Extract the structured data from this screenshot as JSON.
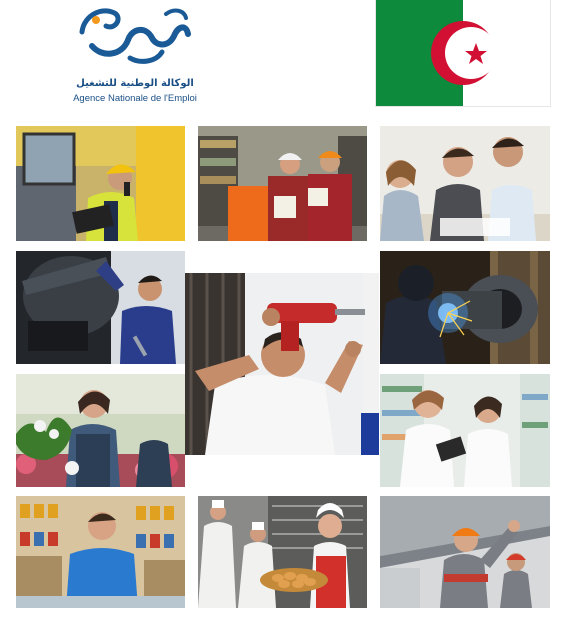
{
  "logo": {
    "arabic_text": "الوكالة الوطنية للتشغيل",
    "french_text": "Agence Nationale de l'Emploi",
    "colors": {
      "blue": "#1a5a96",
      "orange": "#f39a1e"
    }
  },
  "flag": {
    "country": "Algeria",
    "colors": {
      "green": "#0d8a3b",
      "white": "#ffffff",
      "red": "#d21034"
    }
  },
  "photos": [
    "construction-worker-on-radio",
    "warehouse-forklift-workers",
    "office-team-at-desk",
    "car-mechanic",
    "man-using-power-drill",
    "welder-with-sparks",
    "florist-with-plants",
    "pharmacists-in-pharmacy",
    "hardware-store-clerk",
    "bakers-with-bread-tray",
    "industrial-worker-in-hardhat"
  ]
}
